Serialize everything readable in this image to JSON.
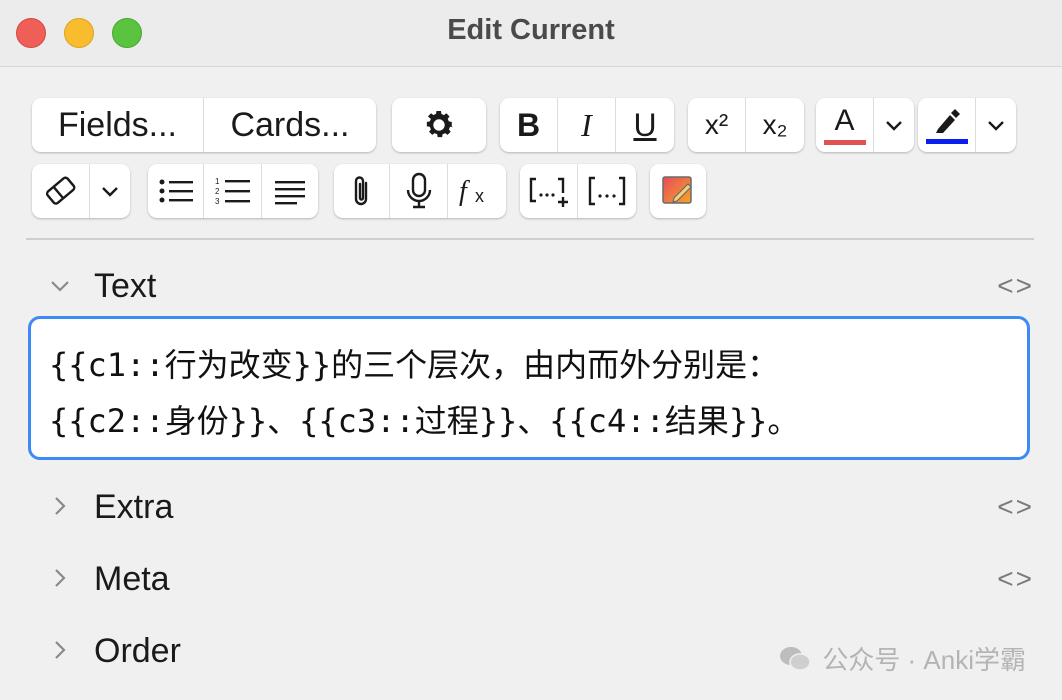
{
  "window": {
    "title": "Edit Current"
  },
  "toolbar": {
    "fields_label": "Fields...",
    "cards_label": "Cards...",
    "bold": "B",
    "italic": "I",
    "underline": "U",
    "superscript": "x²",
    "subscript": "x₂",
    "text_color_letter": "A",
    "colors": {
      "text_color": "#e05252",
      "highlight_color": "#0a1ef0",
      "accent": "#3d8af7"
    },
    "icons": [
      "gear-icon",
      "chevron-down-icon",
      "eraser-icon",
      "bullet-list-icon",
      "numbered-list-icon",
      "align-icon",
      "paperclip-icon",
      "microphone-icon",
      "function-icon",
      "cloze-new-icon",
      "cloze-icon",
      "image-occlusion-icon"
    ]
  },
  "fields": [
    {
      "name": "Text",
      "expanded": true,
      "code_toggle": "<>"
    },
    {
      "name": "Extra",
      "expanded": false,
      "code_toggle": "<>"
    },
    {
      "name": "Meta",
      "expanded": false,
      "code_toggle": "<>"
    },
    {
      "name": "Order",
      "expanded": false,
      "code_toggle": ""
    }
  ],
  "editor": {
    "line1": "{{c1::行为改变}}的三个层次，由内而外分别是：",
    "line2": "{{c2::身份}}、{{c3::过程}}、{{c4::结果}}。"
  },
  "watermark": {
    "text": "公众号 · Anki学霸"
  }
}
